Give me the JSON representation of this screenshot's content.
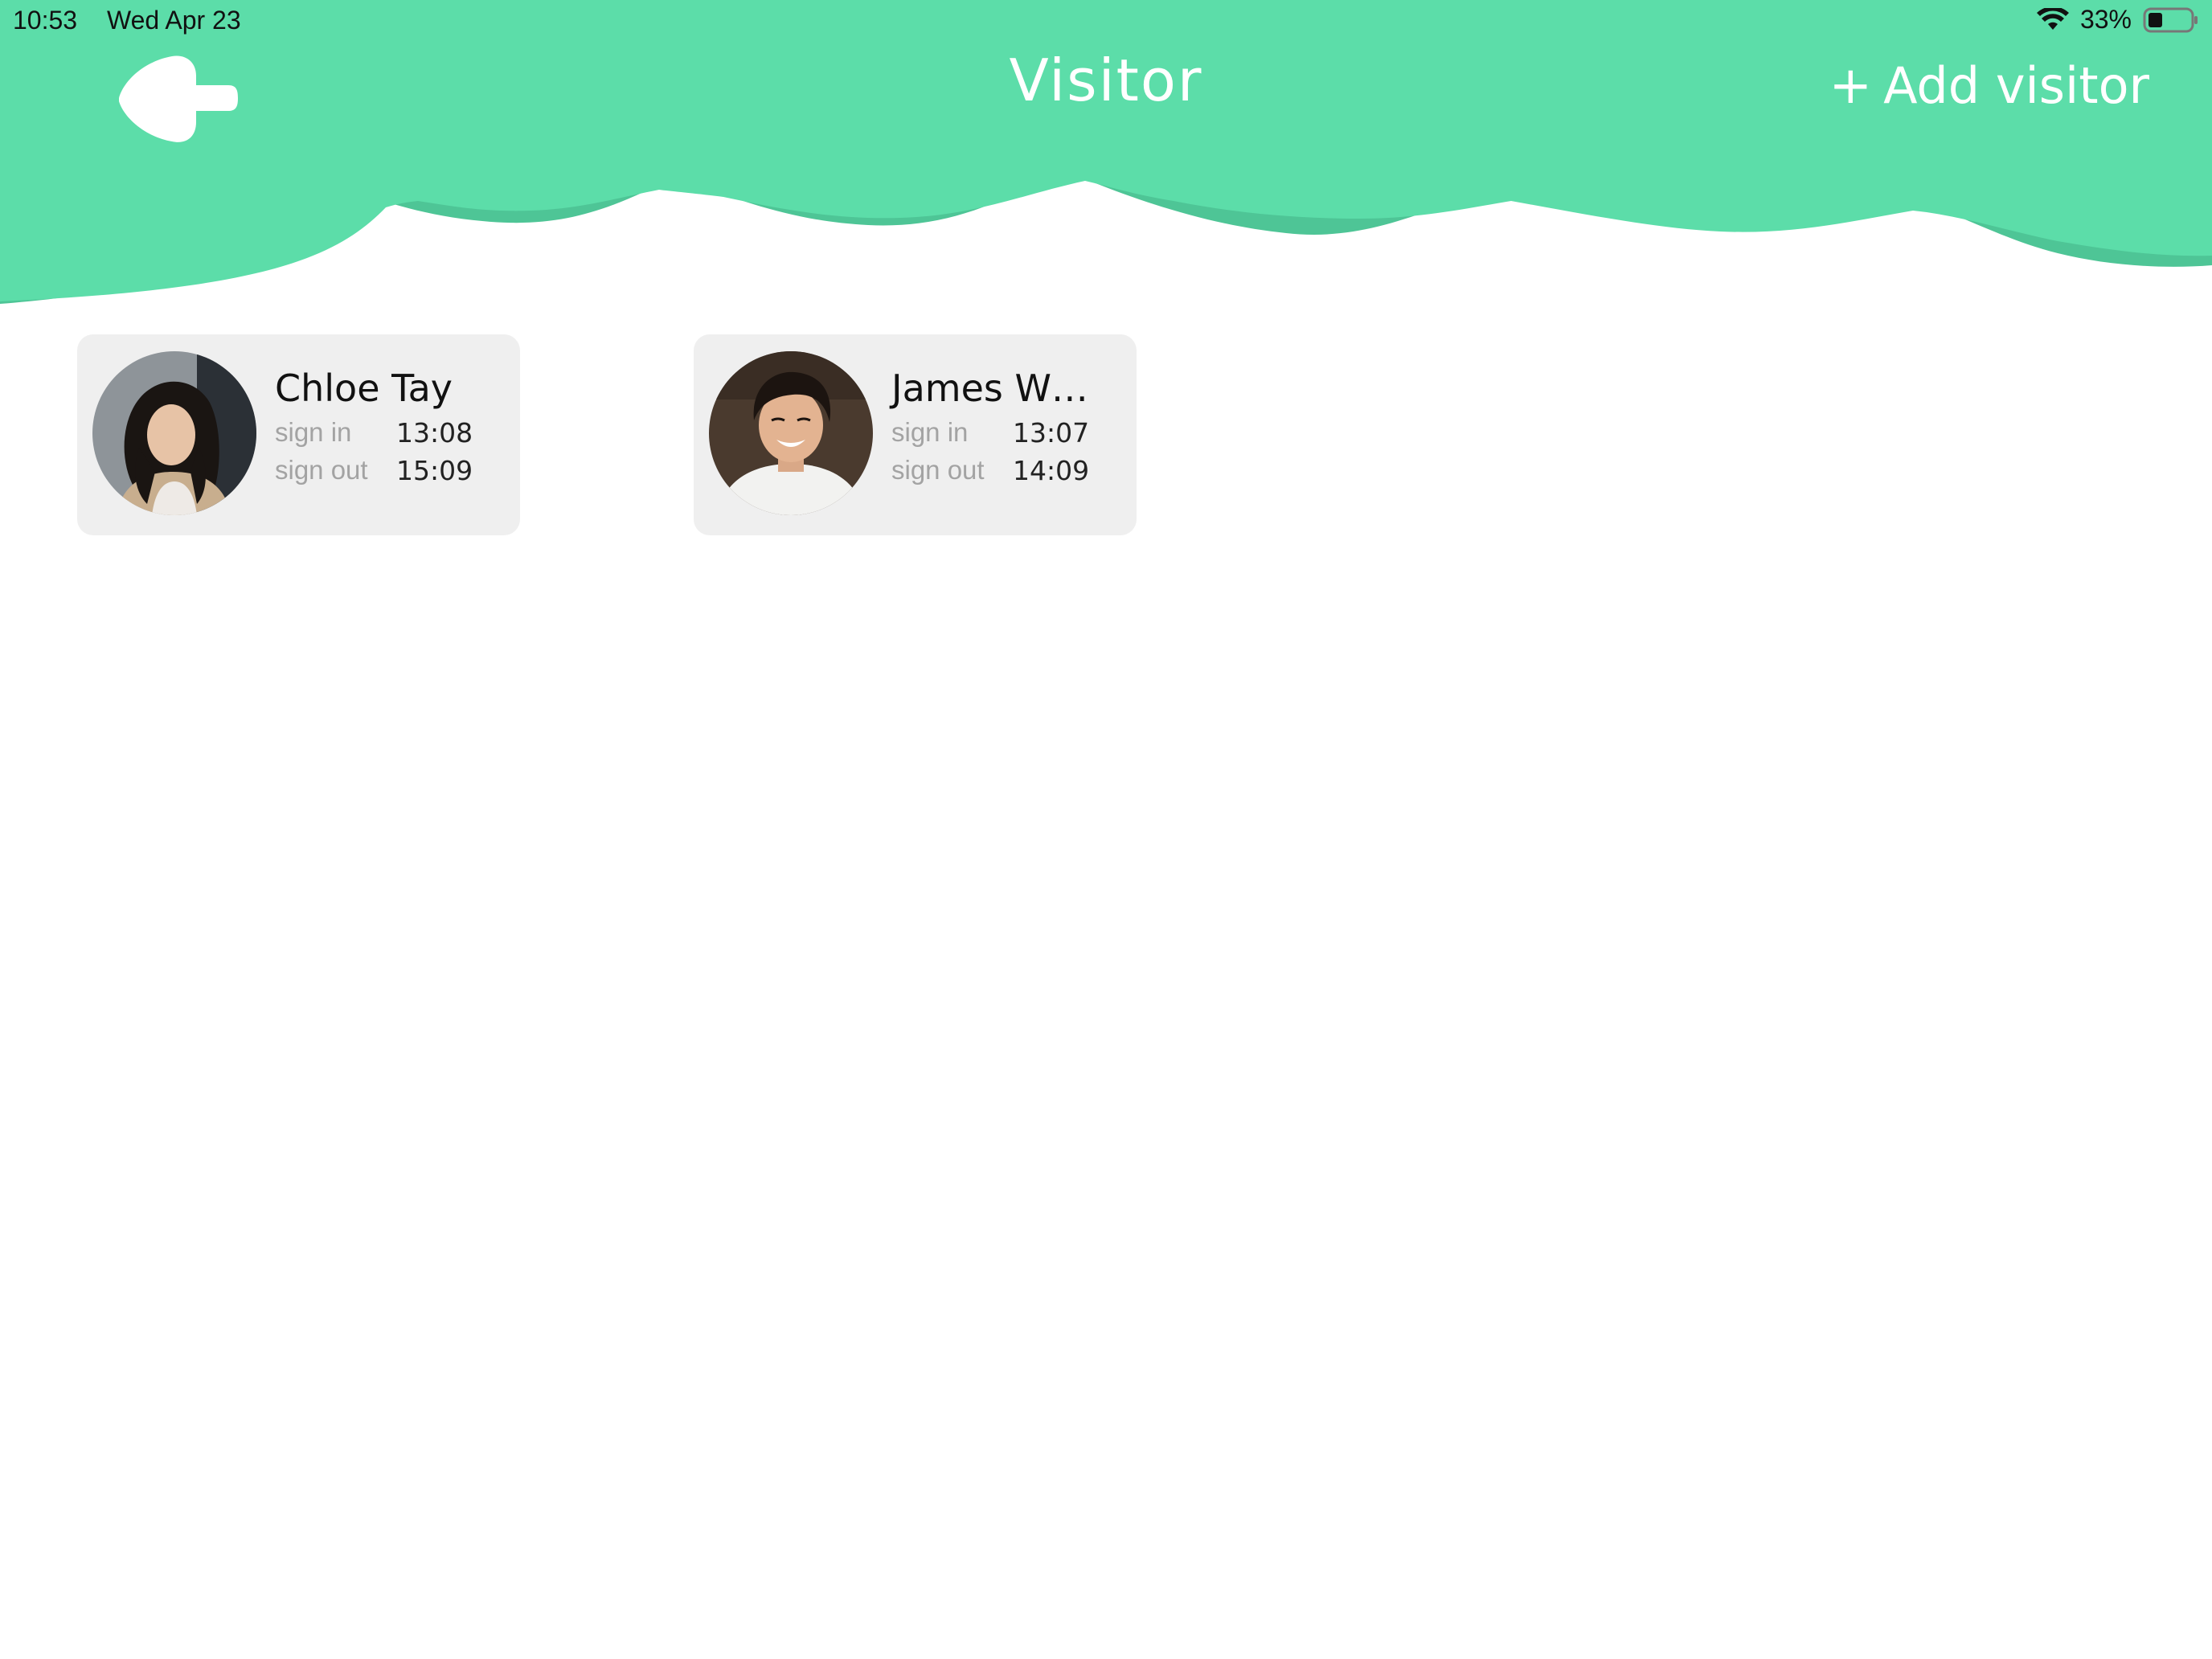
{
  "status_bar": {
    "time": "10:53",
    "date": "Wed Apr 23",
    "battery": "33%",
    "battery_level": 0.33,
    "icons": [
      "wifi-icon",
      "battery-icon"
    ]
  },
  "header": {
    "back_icon": "cloud-arrow-back-icon",
    "title": "Visitor",
    "add_button": {
      "icon": "+",
      "label": "Add visitor"
    },
    "colors": {
      "primary": "#5cdda9",
      "shadow": "#4ec596"
    }
  },
  "visitors": [
    {
      "name": "Chloe Tay",
      "sign_in_label": "sign in",
      "sign_in_time": "13:08",
      "sign_out_label": "sign out",
      "sign_out_time": "15:09",
      "avatar_icon": "avatar-photo"
    },
    {
      "name": "James W…",
      "sign_in_label": "sign in",
      "sign_in_time": "13:07",
      "sign_out_label": "sign out",
      "sign_out_time": "14:09",
      "avatar_icon": "avatar-photo"
    }
  ]
}
